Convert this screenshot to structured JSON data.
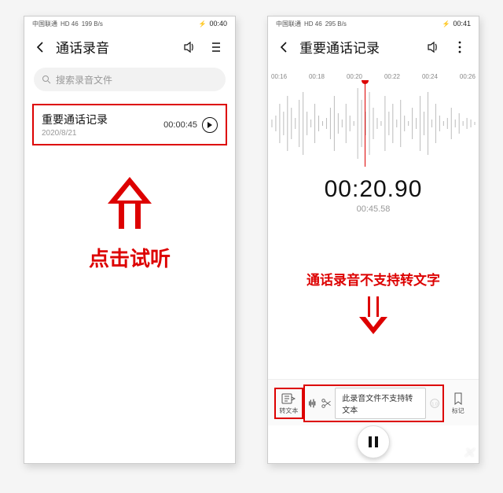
{
  "left": {
    "status": {
      "carrier": "中国联通",
      "net": "HD 46",
      "speed": "199 B/s",
      "battery": "⚡",
      "time": "00:40"
    },
    "appbar": {
      "title": "通话录音"
    },
    "search": {
      "placeholder": "搜索录音文件"
    },
    "item": {
      "name": "重要通话记录",
      "date": "2020/8/21",
      "duration": "00:00:45"
    },
    "annotation": "点击试听"
  },
  "right": {
    "status": {
      "carrier": "中国联通",
      "net": "HD 46",
      "speed": "295 B/s",
      "battery": "⚡",
      "time": "00:41"
    },
    "appbar": {
      "title": "重要通话记录"
    },
    "ruler": [
      "00:16",
      "00:18",
      "00:20",
      "00:22",
      "00:24",
      "00:26"
    ],
    "time": {
      "current": "00:20.90",
      "total": "00:45.58"
    },
    "annotation": "通话录音不支持转文字",
    "toolbar": {
      "transcribe": "转文本",
      "toast": "此录音文件不支持转文本",
      "bookmark": "标记"
    }
  }
}
